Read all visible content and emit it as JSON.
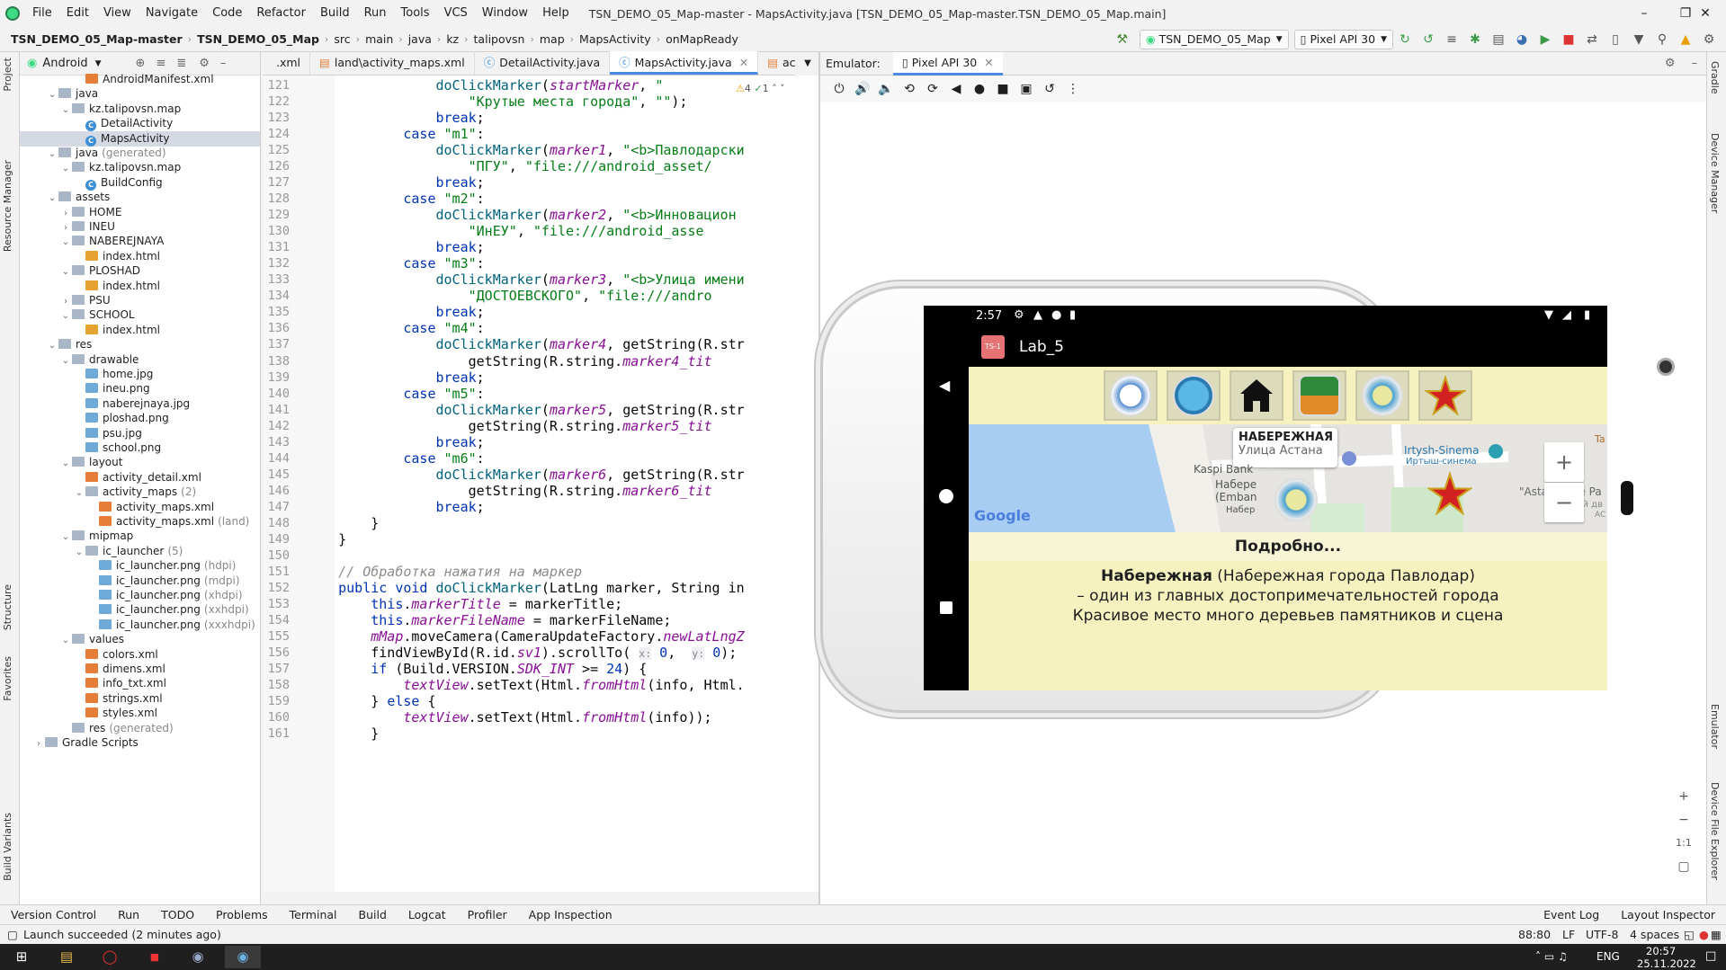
{
  "menu": [
    "File",
    "Edit",
    "View",
    "Navigate",
    "Code",
    "Refactor",
    "Build",
    "Run",
    "Tools",
    "VCS",
    "Window",
    "Help"
  ],
  "window_title": "TSN_DEMO_05_Map-master - MapsActivity.java [TSN_DEMO_05_Map-master.TSN_DEMO_05_Map.main]",
  "breadcrumb": [
    "TSN_DEMO_05_Map-master",
    "TSN_DEMO_05_Map",
    "src",
    "main",
    "java",
    "kz",
    "talipovsn",
    "map",
    "MapsActivity",
    "onMapReady"
  ],
  "run_config": "TSN_DEMO_05_Map",
  "device": "Pixel API 30",
  "project_panel": {
    "view": "Android"
  },
  "tree": [
    {
      "label": "AndroidManifest.xml",
      "indent": 3,
      "icon": "xml",
      "arrow": ""
    },
    {
      "label": "java",
      "indent": 1,
      "icon": "folder",
      "arrow": "v"
    },
    {
      "label": "kz.talipovsn.map",
      "indent": 2,
      "icon": "folder",
      "arrow": "v"
    },
    {
      "label": "DetailActivity",
      "indent": 3,
      "icon": "cls",
      "arrow": ""
    },
    {
      "label": "MapsActivity",
      "indent": 3,
      "icon": "cls",
      "arrow": "",
      "selected": true
    },
    {
      "label": "java",
      "suffix": "(generated)",
      "indent": 1,
      "icon": "folder",
      "arrow": "v"
    },
    {
      "label": "kz.talipovsn.map",
      "indent": 2,
      "icon": "folder",
      "arrow": "v"
    },
    {
      "label": "BuildConfig",
      "indent": 3,
      "icon": "cls",
      "arrow": ""
    },
    {
      "label": "assets",
      "indent": 1,
      "icon": "folder",
      "arrow": "v"
    },
    {
      "label": "HOME",
      "indent": 2,
      "icon": "folder",
      "arrow": ">"
    },
    {
      "label": "INEU",
      "indent": 2,
      "icon": "folder",
      "arrow": ">"
    },
    {
      "label": "NABEREJNAYA",
      "indent": 2,
      "icon": "folder",
      "arrow": "v"
    },
    {
      "label": "index.html",
      "indent": 3,
      "icon": "html",
      "arrow": ""
    },
    {
      "label": "PLOSHAD",
      "indent": 2,
      "icon": "folder",
      "arrow": "v"
    },
    {
      "label": "index.html",
      "indent": 3,
      "icon": "html",
      "arrow": ""
    },
    {
      "label": "PSU",
      "indent": 2,
      "icon": "folder",
      "arrow": ">"
    },
    {
      "label": "SCHOOL",
      "indent": 2,
      "icon": "folder",
      "arrow": "v"
    },
    {
      "label": "index.html",
      "indent": 3,
      "icon": "html",
      "arrow": ""
    },
    {
      "label": "res",
      "indent": 1,
      "icon": "folder",
      "arrow": "v"
    },
    {
      "label": "drawable",
      "indent": 2,
      "icon": "folder",
      "arrow": "v"
    },
    {
      "label": "home.jpg",
      "indent": 3,
      "icon": "img",
      "arrow": ""
    },
    {
      "label": "ineu.png",
      "indent": 3,
      "icon": "img",
      "arrow": ""
    },
    {
      "label": "naberejnaya.jpg",
      "indent": 3,
      "icon": "img",
      "arrow": ""
    },
    {
      "label": "ploshad.png",
      "indent": 3,
      "icon": "img",
      "arrow": ""
    },
    {
      "label": "psu.jpg",
      "indent": 3,
      "icon": "img",
      "arrow": ""
    },
    {
      "label": "school.png",
      "indent": 3,
      "icon": "img",
      "arrow": ""
    },
    {
      "label": "layout",
      "indent": 2,
      "icon": "folder",
      "arrow": "v"
    },
    {
      "label": "activity_detail.xml",
      "indent": 3,
      "icon": "xml",
      "arrow": ""
    },
    {
      "label": "activity_maps",
      "suffix": "(2)",
      "indent": 3,
      "icon": "folder",
      "arrow": "v"
    },
    {
      "label": "activity_maps.xml",
      "indent": 4,
      "icon": "xml",
      "arrow": ""
    },
    {
      "label": "activity_maps.xml",
      "suffix": "(land)",
      "indent": 4,
      "icon": "xml",
      "arrow": ""
    },
    {
      "label": "mipmap",
      "indent": 2,
      "icon": "folder",
      "arrow": "v"
    },
    {
      "label": "ic_launcher",
      "suffix": "(5)",
      "indent": 3,
      "icon": "folder",
      "arrow": "v"
    },
    {
      "label": "ic_launcher.png",
      "suffix": "(hdpi)",
      "indent": 4,
      "icon": "img",
      "arrow": ""
    },
    {
      "label": "ic_launcher.png",
      "suffix": "(mdpi)",
      "indent": 4,
      "icon": "img",
      "arrow": ""
    },
    {
      "label": "ic_launcher.png",
      "suffix": "(xhdpi)",
      "indent": 4,
      "icon": "img",
      "arrow": ""
    },
    {
      "label": "ic_launcher.png",
      "suffix": "(xxhdpi)",
      "indent": 4,
      "icon": "img",
      "arrow": ""
    },
    {
      "label": "ic_launcher.png",
      "suffix": "(xxxhdpi)",
      "indent": 4,
      "icon": "img",
      "arrow": ""
    },
    {
      "label": "values",
      "indent": 2,
      "icon": "folder",
      "arrow": "v"
    },
    {
      "label": "colors.xml",
      "indent": 3,
      "icon": "xml",
      "arrow": ""
    },
    {
      "label": "dimens.xml",
      "indent": 3,
      "icon": "xml",
      "arrow": ""
    },
    {
      "label": "info_txt.xml",
      "indent": 3,
      "icon": "xml",
      "arrow": ""
    },
    {
      "label": "strings.xml",
      "indent": 3,
      "icon": "xml",
      "arrow": ""
    },
    {
      "label": "styles.xml",
      "indent": 3,
      "icon": "xml",
      "arrow": ""
    },
    {
      "label": "res",
      "suffix": "(generated)",
      "indent": 2,
      "icon": "folder",
      "arrow": ""
    },
    {
      "label": "Gradle Scripts",
      "indent": 0,
      "icon": "folder",
      "arrow": ">"
    }
  ],
  "editor_tabs": [
    ".xml",
    "land\\activity_maps.xml",
    "DetailActivity.java",
    "MapsActivity.java",
    "activity_de"
  ],
  "active_tab": 3,
  "code_lines": [
    {
      "n": "121",
      "html": "                <span class=\"fn\">doClickMarker</span>(<span class=\"it\">startMarker</span>, <span class=\"str\">\"</span>"
    },
    {
      "n": "122",
      "html": "                    <span class=\"str\">\"Крутые места города\"</span>, <span class=\"str\">\"\"</span>);"
    },
    {
      "n": "123",
      "html": "                <span class=\"kw\">break</span>;"
    },
    {
      "n": "124",
      "html": "            <span class=\"kw\">case</span> <span class=\"str\">\"m1\"</span>:"
    },
    {
      "n": "125",
      "html": "                <span class=\"fn\">doClickMarker</span>(<span class=\"it\">marker1</span>, <span class=\"str\">\"&lt;b&gt;Павлодарски</span>"
    },
    {
      "n": "126",
      "html": "                    <span class=\"str\">\"ПГУ\"</span>, <span class=\"str\">\"file:///android_asset/</span>"
    },
    {
      "n": "127",
      "html": "                <span class=\"kw\">break</span>;"
    },
    {
      "n": "128",
      "html": "            <span class=\"kw\">case</span> <span class=\"str\">\"m2\"</span>:"
    },
    {
      "n": "129",
      "html": "                <span class=\"fn\">doClickMarker</span>(<span class=\"it\">marker2</span>, <span class=\"str\">\"&lt;b&gt;Инновацион</span>"
    },
    {
      "n": "130",
      "html": "                    <span class=\"str\">\"ИнЕУ\"</span>, <span class=\"str\">\"file:///android_asse</span>"
    },
    {
      "n": "131",
      "html": "                <span class=\"kw\">break</span>;"
    },
    {
      "n": "132",
      "html": "            <span class=\"kw\">case</span> <span class=\"str\">\"m3\"</span>:"
    },
    {
      "n": "133",
      "html": "                <span class=\"fn\">doClickMarker</span>(<span class=\"it\">marker3</span>, <span class=\"str\">\"&lt;b&gt;Улица имени</span>"
    },
    {
      "n": "134",
      "html": "                    <span class=\"str\">\"ДОСТОЕВСКОГО\"</span>, <span class=\"str\">\"file:///andro</span>"
    },
    {
      "n": "135",
      "html": "                <span class=\"kw\">break</span>;"
    },
    {
      "n": "136",
      "html": "            <span class=\"kw\">case</span> <span class=\"str\">\"m4\"</span>:"
    },
    {
      "n": "137",
      "html": "                <span class=\"fn\">doClickMarker</span>(<span class=\"it\">marker4</span>, getString(R.str"
    },
    {
      "n": "138",
      "html": "                    getString(R.string.<span class=\"it\">marker4_tit</span>"
    },
    {
      "n": "139",
      "html": "                <span class=\"kw\">break</span>;"
    },
    {
      "n": "140",
      "html": "            <span class=\"kw\">case</span> <span class=\"str\">\"m5\"</span>:"
    },
    {
      "n": "141",
      "html": "                <span class=\"fn\">doClickMarker</span>(<span class=\"it\">marker5</span>, getString(R.str"
    },
    {
      "n": "142",
      "html": "                    getString(R.string.<span class=\"it\">marker5_tit</span>"
    },
    {
      "n": "143",
      "html": "                <span class=\"kw\">break</span>;"
    },
    {
      "n": "144",
      "html": "            <span class=\"kw\">case</span> <span class=\"str\">\"m6\"</span>:"
    },
    {
      "n": "145",
      "html": "                <span class=\"fn\">doClickMarker</span>(<span class=\"it\">marker6</span>, getString(R.str"
    },
    {
      "n": "146",
      "html": "                    getString(R.string.<span class=\"it\">marker6_tit</span>"
    },
    {
      "n": "147",
      "html": "                <span class=\"kw\">break</span>;"
    },
    {
      "n": "148",
      "html": "        }"
    },
    {
      "n": "149",
      "html": "    }"
    },
    {
      "n": "150",
      "html": ""
    },
    {
      "n": "151",
      "html": "    <span class=\"cm\">// Обработка нажатия на маркер</span>"
    },
    {
      "n": "152",
      "html": "    <span class=\"kw\">public void</span> <span class=\"fn\">doClickMarker</span>(LatLng marker, String in"
    },
    {
      "n": "153",
      "html": "        <span class=\"kw\">this</span>.<span class=\"it\">markerTitle</span> = markerTitle;"
    },
    {
      "n": "154",
      "html": "        <span class=\"kw\">this</span>.<span class=\"it\">markerFileName</span> = markerFileName;"
    },
    {
      "n": "155",
      "html": "        <span class=\"it\">mMap</span>.moveCamera(CameraUpdateFactory.<span class=\"it\">newLatLngZ</span>"
    },
    {
      "n": "156",
      "html": "        findViewById(R.id.<span class=\"it\">sv1</span>).scrollTo( <span class=\"hint\">x:</span> <span class=\"kw\">0</span>,  <span class=\"hint\">y:</span> <span class=\"kw\">0</span>);"
    },
    {
      "n": "157",
      "html": "        <span class=\"kw\">if</span> (Build.VERSION.<span class=\"it\">SDK_INT</span> &gt;= <span class=\"kw\">24</span>) {"
    },
    {
      "n": "158",
      "html": "            <span class=\"it\">textView</span>.setText(Html.<span class=\"it\">fromHtml</span>(info, Html."
    },
    {
      "n": "159",
      "html": "        } <span class=\"kw\">else</span> {"
    },
    {
      "n": "160",
      "html": "            <span class=\"it\">textView</span>.setText(Html.<span class=\"it\">fromHtml</span>(info));"
    },
    {
      "n": "161",
      "html": "        }"
    }
  ],
  "emulator": {
    "label": "Emulator:",
    "device_tab": "Pixel API 30"
  },
  "phone": {
    "time": "2:57",
    "app_title": "Lab_5",
    "app_icon_text": "TS-1",
    "map_popup_title": "НАБЕРЕЖНАЯ",
    "map_street": "Улица Астана",
    "map_labels": [
      "Kaspi Bank",
      "Набере",
      "(Emban",
      "Набер",
      "Irtysh-Sinema",
      "Иртыш-синема",
      "\"Astana\" Ice Pa",
      "Ледовый дв",
      "Ta",
      "АС"
    ],
    "google": "Google",
    "details_header": "Подробно...",
    "info_bold": "Набережная",
    "info_rest": " (Набережная города Павлодар)",
    "info_line2": "– один из главных достопримечательностей города",
    "info_line3": "Красивое место много деревьев памятников и сцена"
  },
  "bottom_tabs": [
    "Version Control",
    "Run",
    "TODO",
    "Problems",
    "Terminal",
    "Build",
    "Logcat",
    "Profiler",
    "App Inspection"
  ],
  "bottom_right_tabs": [
    "Event Log",
    "Layout Inspector"
  ],
  "status": {
    "message": "Launch succeeded (2 minutes ago)",
    "position": "88:80",
    "line_sep": "LF",
    "encoding": "UTF-8",
    "indent": "4 spaces"
  },
  "left_strip": [
    "Project",
    "Resource Manager",
    "Structure",
    "Favorites",
    "Build Variants"
  ],
  "right_strip": [
    "Gradle",
    "Device Manager",
    "Emulator",
    "Device File Explorer"
  ],
  "taskbar": {
    "lang": "ENG",
    "time": "20:57",
    "date": "25.11.2022"
  },
  "emulator_zoom": {
    "ratio": "1:1"
  }
}
